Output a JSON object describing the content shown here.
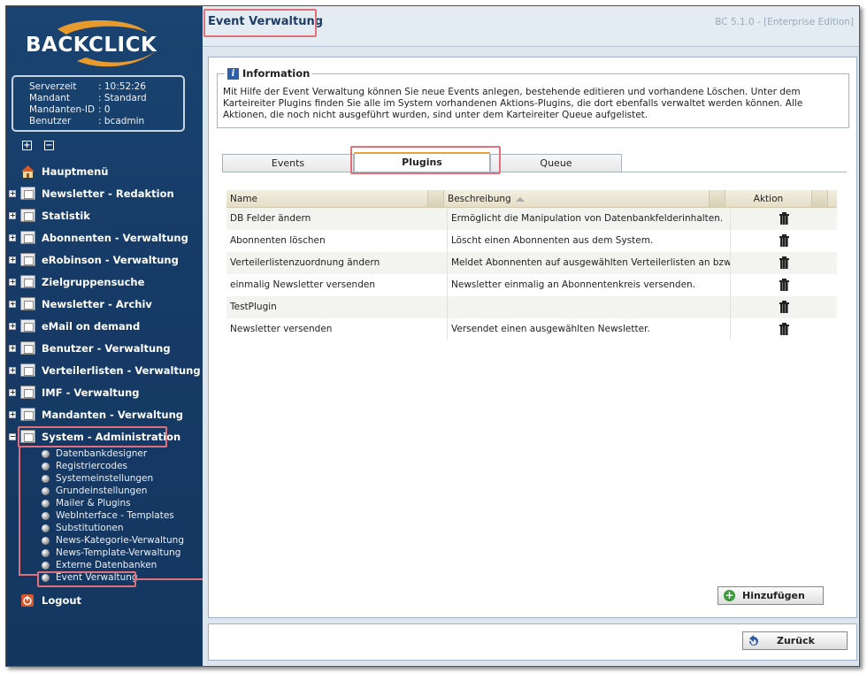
{
  "app": {
    "brand": "BACKCLICK",
    "version": "BC 5.1.0 - [Enterprise Edition]"
  },
  "session": {
    "rows": [
      {
        "key": "Serverzeit",
        "value": ": 10:52:26"
      },
      {
        "key": "Mandant",
        "value": ": Standard"
      },
      {
        "key": "Mandanten-ID",
        "value": ": 0"
      },
      {
        "key": "Benutzer",
        "value": ": bcadmin"
      }
    ]
  },
  "menu": {
    "items": [
      {
        "label": "Hauptmenü",
        "icon": "home-icon"
      },
      {
        "label": "Newsletter - Redaktion",
        "icon": "folder-icon"
      },
      {
        "label": "Statistik",
        "icon": "folder-icon"
      },
      {
        "label": "Abonnenten - Verwaltung",
        "icon": "folder-icon"
      },
      {
        "label": "eRobinson - Verwaltung",
        "icon": "folder-icon"
      },
      {
        "label": "Zielgruppensuche",
        "icon": "folder-icon"
      },
      {
        "label": "Newsletter - Archiv",
        "icon": "folder-icon"
      },
      {
        "label": "eMail on demand",
        "icon": "folder-icon"
      },
      {
        "label": "Benutzer - Verwaltung",
        "icon": "folder-icon"
      },
      {
        "label": "Verteilerlisten - Verwaltung",
        "icon": "folder-icon"
      },
      {
        "label": "IMF - Verwaltung",
        "icon": "folder-icon"
      },
      {
        "label": "Mandanten - Verwaltung",
        "icon": "folder-icon"
      },
      {
        "label": "System - Administration",
        "icon": "folder-open-icon"
      }
    ],
    "system_sub": [
      "Datenbankdesigner",
      "Registriercodes",
      "Systemeinstellungen",
      "Grundeinstellungen",
      "Mailer & Plugins",
      "WebInterface - Templates",
      "Substitutionen",
      "News-Kategorie-Verwaltung",
      "News-Template-Verwaltung",
      "Externe Datenbanken",
      "Event Verwaltung"
    ],
    "logout": "Logout"
  },
  "page": {
    "title": "Event Verwaltung"
  },
  "info": {
    "legend": "Information",
    "text": "Mit Hilfe der Event Verwaltung können Sie neue Events anlegen, bestehende editieren und vorhandene Löschen. Unter dem Karteireiter Plugins finden Sie alle im System vorhandenen Aktions-Plugins, die dort ebenfalls verwaltet werden können. Alle Aktionen, die noch nicht ausgeführt wurden, sind unter dem Karteireiter Queue aufgelistet."
  },
  "tabs": [
    "Events",
    "Plugins",
    "Queue"
  ],
  "active_tab": "Plugins",
  "grid": {
    "columns": [
      "Name",
      "Beschreibung",
      "Aktion"
    ],
    "rows": [
      {
        "name": "DB Felder ändern",
        "desc": "Ermöglicht die Manipulation von Datenbankfelderinhalten."
      },
      {
        "name": "Abonnenten löschen",
        "desc": "Löscht einen Abonnenten aus dem System."
      },
      {
        "name": "Verteilerlistenzuordnung ändern",
        "desc": "Meldet Abonnenten auf ausgewählten Verteilerlisten an bzw. ab."
      },
      {
        "name": "einmalig Newsletter versenden",
        "desc": "Newsletter einmalig an Abonnentenkreis versenden."
      },
      {
        "name": "TestPlugin",
        "desc": ""
      },
      {
        "name": "Newsletter versenden",
        "desc": "Versendet einen ausgewählten Newsletter."
      }
    ]
  },
  "buttons": {
    "add": "Hinzufügen",
    "back": "Zurück"
  },
  "colors": {
    "sidebar": "#163b66",
    "highlight": "#e0707a",
    "tab_accent": "#e6a340"
  }
}
